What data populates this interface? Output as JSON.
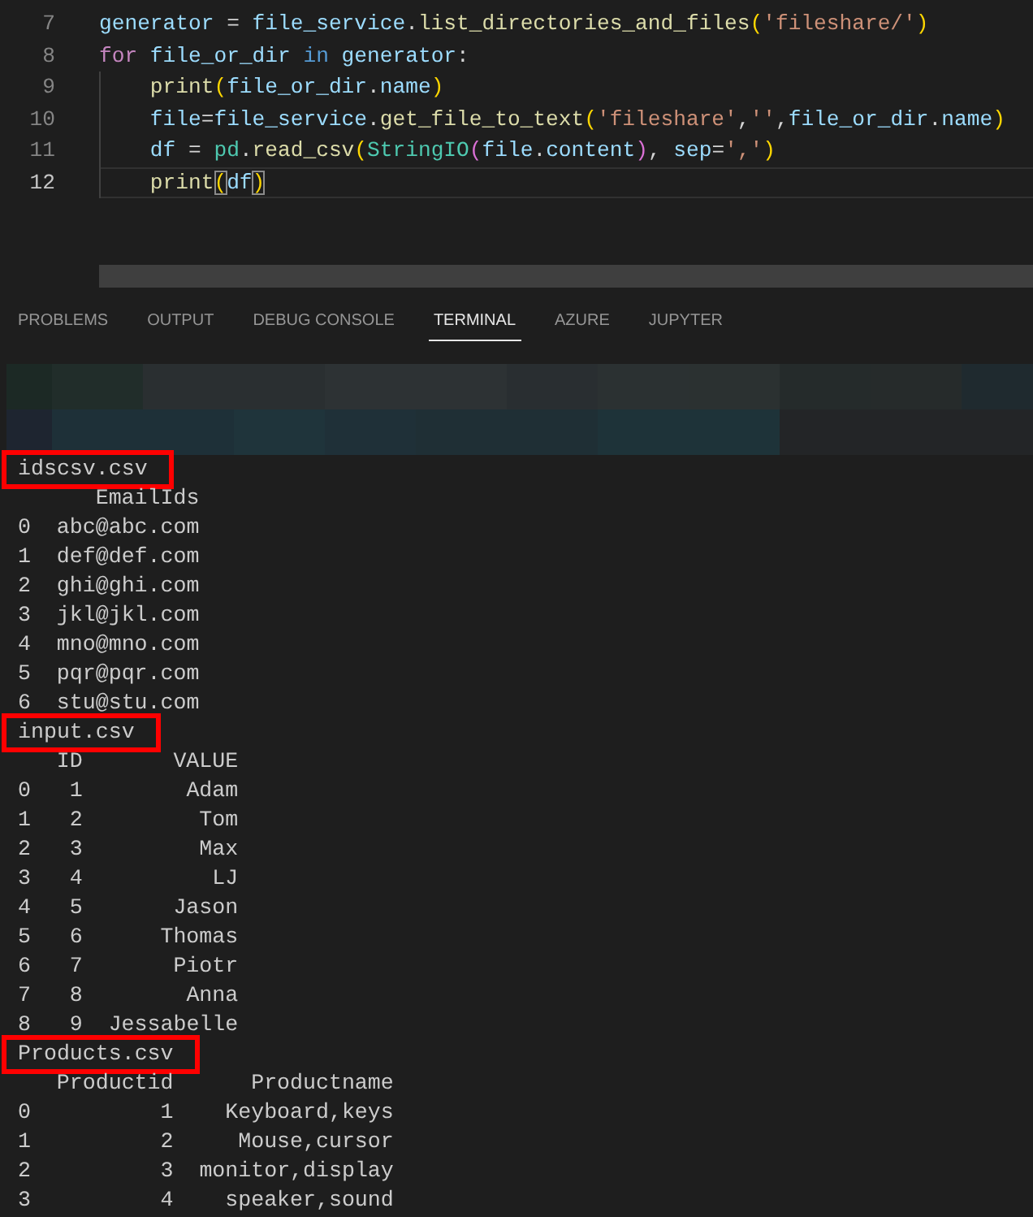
{
  "editor": {
    "lines": [
      {
        "number": "7",
        "current": false,
        "tokens": [
          {
            "text": "generator",
            "kind": "variable"
          },
          {
            "text": " = ",
            "kind": "plain"
          },
          {
            "text": "file_service",
            "kind": "variable"
          },
          {
            "text": ".",
            "kind": "plain"
          },
          {
            "text": "list_directories_and_files",
            "kind": "function"
          },
          {
            "text": "(",
            "kind": "bracket"
          },
          {
            "text": "'fileshare/'",
            "kind": "string"
          },
          {
            "text": ")",
            "kind": "bracket"
          }
        ]
      },
      {
        "number": "8",
        "current": false,
        "tokens": [
          {
            "text": "for",
            "kind": "control"
          },
          {
            "text": " file_or_dir ",
            "kind": "variable"
          },
          {
            "text": "in",
            "kind": "keyword"
          },
          {
            "text": " generator",
            "kind": "variable"
          },
          {
            "text": ":",
            "kind": "plain"
          }
        ],
        "children": [
          {
            "number": "9",
            "current": false,
            "tokens": [
              {
                "text": "print",
                "kind": "function"
              },
              {
                "text": "(",
                "kind": "bracket"
              },
              {
                "text": "file_or_dir",
                "kind": "variable"
              },
              {
                "text": ".",
                "kind": "plain"
              },
              {
                "text": "name",
                "kind": "variable"
              },
              {
                "text": ")",
                "kind": "bracket"
              }
            ]
          },
          {
            "number": "10",
            "current": false,
            "tokens": [
              {
                "text": "file",
                "kind": "variable"
              },
              {
                "text": "=",
                "kind": "plain"
              },
              {
                "text": "file_service",
                "kind": "variable"
              },
              {
                "text": ".",
                "kind": "plain"
              },
              {
                "text": "get_file_to_text",
                "kind": "function"
              },
              {
                "text": "(",
                "kind": "bracket"
              },
              {
                "text": "'fileshare'",
                "kind": "string"
              },
              {
                "text": ",",
                "kind": "plain"
              },
              {
                "text": "''",
                "kind": "string"
              },
              {
                "text": ",",
                "kind": "plain"
              },
              {
                "text": "file_or_dir",
                "kind": "variable"
              },
              {
                "text": ".",
                "kind": "plain"
              },
              {
                "text": "name",
                "kind": "variable"
              },
              {
                "text": ")",
                "kind": "bracket"
              }
            ]
          },
          {
            "number": "11",
            "current": false,
            "tokens": [
              {
                "text": "df",
                "kind": "variable"
              },
              {
                "text": " = ",
                "kind": "plain"
              },
              {
                "text": "pd",
                "kind": "type"
              },
              {
                "text": ".",
                "kind": "plain"
              },
              {
                "text": "read_csv",
                "kind": "function"
              },
              {
                "text": "(",
                "kind": "bracket"
              },
              {
                "text": "StringIO",
                "kind": "type"
              },
              {
                "text": "(",
                "kind": "bracket-nested"
              },
              {
                "text": "file",
                "kind": "variable"
              },
              {
                "text": ".",
                "kind": "plain"
              },
              {
                "text": "content",
                "kind": "variable"
              },
              {
                "text": ")",
                "kind": "bracket-nested"
              },
              {
                "text": ", ",
                "kind": "plain"
              },
              {
                "text": "sep",
                "kind": "variable"
              },
              {
                "text": "=",
                "kind": "plain"
              },
              {
                "text": "','",
                "kind": "string"
              },
              {
                "text": ")",
                "kind": "bracket"
              }
            ]
          },
          {
            "number": "12",
            "current": true,
            "tokens": [
              {
                "text": "print",
                "kind": "function"
              },
              {
                "text": "(",
                "kind": "bracket-matched"
              },
              {
                "text": "df",
                "kind": "variable"
              },
              {
                "text": ")",
                "kind": "bracket-matched"
              }
            ]
          }
        ]
      }
    ]
  },
  "panel": {
    "tabs": [
      {
        "label": "PROBLEMS",
        "selected": false
      },
      {
        "label": "OUTPUT",
        "selected": false
      },
      {
        "label": "DEBUG CONSOLE",
        "selected": false
      },
      {
        "label": "TERMINAL",
        "selected": true
      },
      {
        "label": "AZURE",
        "selected": false
      },
      {
        "label": "JUPYTER",
        "selected": false
      }
    ]
  },
  "terminal": {
    "outputs": [
      {
        "file_name": "idscsv.csv",
        "highlighted": true,
        "columns": [
          "EmailIds"
        ],
        "rows": [
          {
            "index": "0",
            "cells": [
              "abc@abc.com"
            ]
          },
          {
            "index": "1",
            "cells": [
              "def@def.com"
            ]
          },
          {
            "index": "2",
            "cells": [
              "ghi@ghi.com"
            ]
          },
          {
            "index": "3",
            "cells": [
              "jkl@jkl.com"
            ]
          },
          {
            "index": "4",
            "cells": [
              "mno@mno.com"
            ]
          },
          {
            "index": "5",
            "cells": [
              "pqr@pqr.com"
            ]
          },
          {
            "index": "6",
            "cells": [
              "stu@stu.com"
            ]
          }
        ]
      },
      {
        "file_name": "input.csv",
        "highlighted": true,
        "columns": [
          "ID",
          "VALUE"
        ],
        "rows": [
          {
            "index": "0",
            "cells": [
              "1",
              "Adam"
            ]
          },
          {
            "index": "1",
            "cells": [
              "2",
              "Tom"
            ]
          },
          {
            "index": "2",
            "cells": [
              "3",
              "Max"
            ]
          },
          {
            "index": "3",
            "cells": [
              "4",
              "LJ"
            ]
          },
          {
            "index": "4",
            "cells": [
              "5",
              "Jason"
            ]
          },
          {
            "index": "5",
            "cells": [
              "6",
              "Thomas"
            ]
          },
          {
            "index": "6",
            "cells": [
              "7",
              "Piotr"
            ]
          },
          {
            "index": "7",
            "cells": [
              "8",
              "Anna"
            ]
          },
          {
            "index": "8",
            "cells": [
              "9",
              "Jessabelle"
            ]
          }
        ]
      },
      {
        "file_name": "Products.csv",
        "highlighted": true,
        "columns": [
          "Productid",
          "Productname"
        ],
        "rows": [
          {
            "index": "0",
            "cells": [
              "1",
              "Keyboard,keys"
            ]
          },
          {
            "index": "1",
            "cells": [
              "2",
              "Mouse,cursor"
            ]
          },
          {
            "index": "2",
            "cells": [
              "3",
              "monitor,display"
            ]
          },
          {
            "index": "3",
            "cells": [
              "4",
              "speaker,sound"
            ]
          }
        ]
      }
    ]
  }
}
